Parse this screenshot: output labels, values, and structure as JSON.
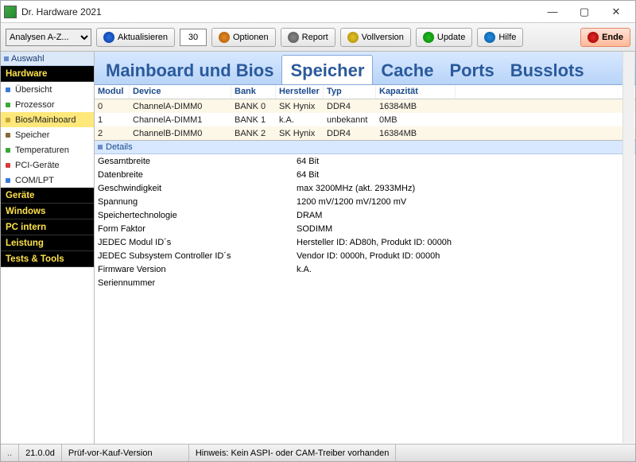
{
  "app": {
    "title": "Dr. Hardware 2021"
  },
  "toolbar": {
    "dropdown": "Analysen A-Z...",
    "refresh": "Aktualisieren",
    "spin": "30",
    "options": "Optionen",
    "report": "Report",
    "fullversion": "Vollversion",
    "update": "Update",
    "help": "Hilfe",
    "end": "Ende"
  },
  "sidebar": {
    "auswahl": "Auswahl",
    "categories": [
      "Hardware",
      "Geräte",
      "Windows",
      "PC intern",
      "Leistung",
      "Tests & Tools"
    ],
    "hardware_items": [
      {
        "label": "Übersicht",
        "bullet": "b-blue"
      },
      {
        "label": "Prozessor",
        "bullet": "b-grn"
      },
      {
        "label": "Bios/Mainboard",
        "bullet": "b-gold",
        "selected": true
      },
      {
        "label": "Speicher",
        "bullet": "b-brn"
      },
      {
        "label": "Temperaturen",
        "bullet": "b-grn"
      },
      {
        "label": "PCI-Geräte",
        "bullet": "b-red"
      },
      {
        "label": "COM/LPT",
        "bullet": "b-blue"
      }
    ]
  },
  "tabs": {
    "items": [
      "Mainboard und Bios",
      "Speicher",
      "Cache",
      "Ports",
      "Busslots"
    ],
    "active": 1
  },
  "grid": {
    "headers": {
      "modul": "Modul",
      "device": "Device",
      "bank": "Bank",
      "hersteller": "Hersteller",
      "typ": "Typ",
      "kapazitaet": "Kapazität"
    },
    "rows": [
      {
        "modul": "0",
        "device": "ChannelA-DIMM0",
        "bank": "BANK 0",
        "herst": "SK Hynix",
        "typ": "DDR4",
        "kap": "16384MB"
      },
      {
        "modul": "1",
        "device": "ChannelA-DIMM1",
        "bank": "BANK 1",
        "herst": "k.A.",
        "typ": "unbekannt",
        "kap": "0MB"
      },
      {
        "modul": "2",
        "device": "ChannelB-DIMM0",
        "bank": "BANK 2",
        "herst": "SK Hynix",
        "typ": "DDR4",
        "kap": "16384MB"
      }
    ]
  },
  "details": {
    "header": "Details",
    "rows": [
      {
        "k": "Gesamtbreite",
        "v": "64 Bit"
      },
      {
        "k": "Datenbreite",
        "v": "64 Bit"
      },
      {
        "k": "Geschwindigkeit",
        "v": "max 3200MHz (akt. 2933MHz)"
      },
      {
        "k": "Spannung",
        "v": "1200 mV/1200 mV/1200 mV"
      },
      {
        "k": "Speichertechnologie",
        "v": "DRAM"
      },
      {
        "k": "Form Faktor",
        "v": "SODIMM"
      },
      {
        "k": "JEDEC Modul ID´s",
        "v": "Hersteller ID: AD80h, Produkt ID: 0000h"
      },
      {
        "k": "JEDEC Subsystem Controller ID´s",
        "v": "Vendor ID: 0000h, Produkt ID: 0000h"
      },
      {
        "k": "Firmware Version",
        "v": "k.A."
      },
      {
        "k": "Seriennummer",
        "v": ""
      }
    ]
  },
  "status": {
    "version": "21.0.0d",
    "edition": "Prüf-vor-Kauf-Version",
    "hint_label": "Hinweis:",
    "hint": "Kein ASPI- oder CAM-Treiber vorhanden"
  }
}
